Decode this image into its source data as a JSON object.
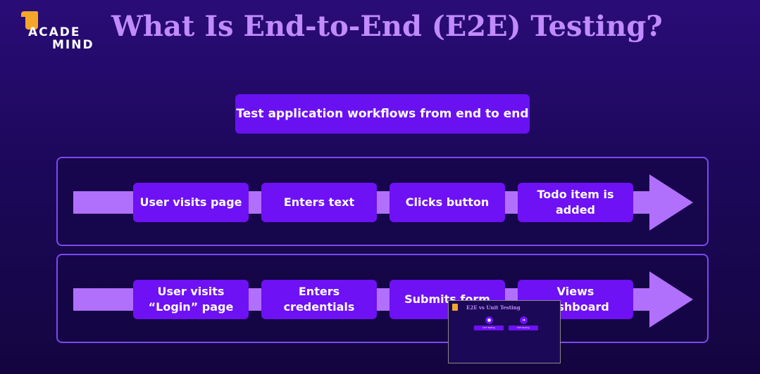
{
  "logo": {
    "line1": "ACADE",
    "line2": "MIND"
  },
  "title": "What Is End-to-End (E2E) Testing?",
  "subtitle": "Test application workflows from end to end",
  "flows": [
    {
      "steps": [
        "User visits page",
        "Enters text",
        "Clicks button",
        "Todo item is added"
      ]
    },
    {
      "steps": [
        "User visits “Login” page",
        "Enters credentials",
        "Submits form",
        "Views dashboard"
      ]
    }
  ],
  "thumbnail": {
    "title": "E2E vs Unit Testing",
    "buttons": [
      "Unit Testing",
      "E2E Testing"
    ],
    "icons": [
      "chat-icon",
      "arrow-right-icon"
    ]
  },
  "colors": {
    "title": "#c18bff",
    "box": "#6e11f5",
    "arrow": "#b170fb",
    "panel_border": "#7b49f0",
    "logo_accent": "#f4a62a"
  }
}
